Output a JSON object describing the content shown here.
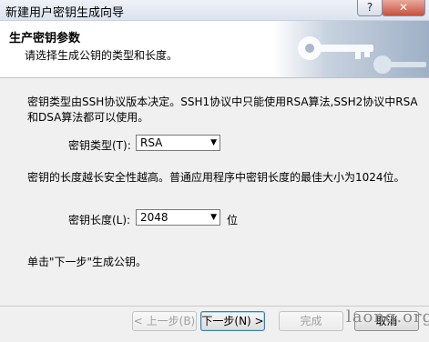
{
  "window": {
    "title": "新建用户密钥生成向导",
    "help_label": "?",
    "close_label": "✕"
  },
  "header": {
    "title": "生产密钥参数",
    "subtitle": "请选择生成公钥的类型和长度。"
  },
  "content": {
    "intro": "密钥类型由SSH协议版本决定。SSH1协议中只能使用RSA算法,SSH2协议中RSA和DSA算法都可以使用。",
    "key_type_label": "密钥类型(T):",
    "key_type_value": "RSA",
    "security_text": "密钥的长度越长安全性越高。普通应用程序中密钥长度的最佳大小为1024位。",
    "key_length_label": "密钥长度(L):",
    "key_length_value": "2048",
    "key_length_unit": "位",
    "next_hint": "单击\"下一步\"生成公钥。"
  },
  "buttons": {
    "back": "< 上一步(B)",
    "next": "下一步(N) >",
    "finish": "完成",
    "cancel": "取消"
  },
  "watermark": "laonq.org"
}
